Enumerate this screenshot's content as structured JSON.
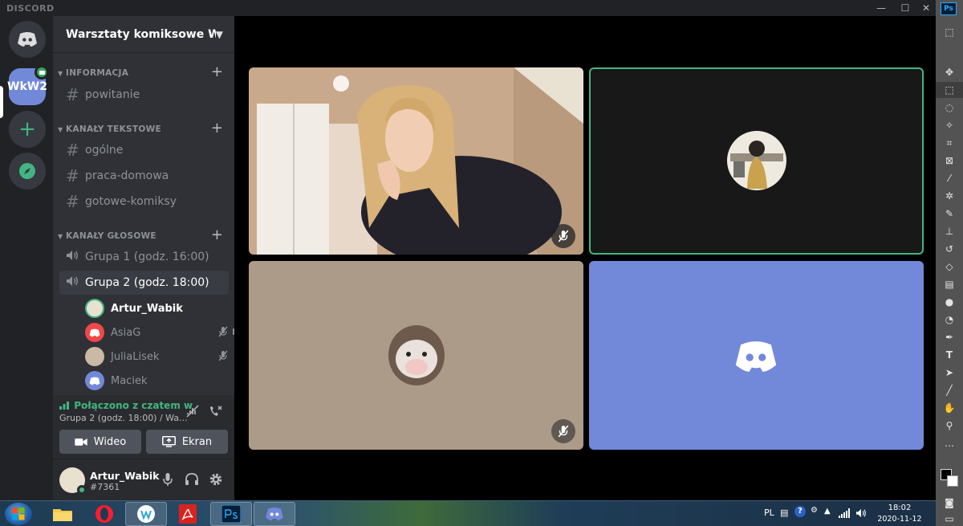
{
  "window": {
    "brand": "DISCORD",
    "minimize": "—",
    "maximize": "☐",
    "close": "✕"
  },
  "guilds": [
    {
      "name": "home",
      "label": ""
    },
    {
      "name": "server-wkw",
      "label": "WkW2"
    },
    {
      "name": "add-server",
      "label": "+"
    },
    {
      "name": "explore",
      "label": ""
    }
  ],
  "server": {
    "name": "Warsztaty komiksowe W...",
    "categories": [
      {
        "name": "INFORMACJA",
        "channels": [
          "powitanie"
        ]
      },
      {
        "name": "KANAŁY TEKSTOWE",
        "channels": [
          "ogólne",
          "praca-domowa",
          "gotowe-komiksy"
        ]
      },
      {
        "name": "KANAŁY GŁOSOWE",
        "channels": [
          "Grupa 1 (godz. 16:00)",
          "Grupa 2 (godz. 18:00)"
        ]
      }
    ],
    "voice_users": [
      "Artur_Wabik",
      "AsiaG",
      "JuliaLisek",
      "Maciek"
    ]
  },
  "voice_panel": {
    "status": "Połączono z czatem w",
    "channel": "Grupa 2 (godz. 18:00) / Wa...",
    "video_label": "Wideo",
    "screen_label": "Ekran"
  },
  "user_panel": {
    "username": "Artur_Wabik",
    "tag": "#7361"
  },
  "photoshop": {
    "badge": "Ps"
  },
  "taskbar": {
    "lang": "PL",
    "time": "18:02",
    "date": "2020-11-12"
  },
  "colors": {
    "blurple": "#7289da",
    "green": "#43b581",
    "speaking": "#43b581",
    "tile_tan": "#ad9b89"
  }
}
